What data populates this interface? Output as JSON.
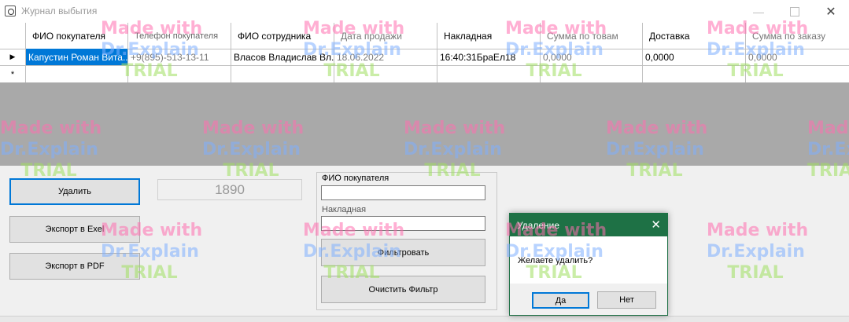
{
  "window": {
    "title": "Журнал выбытия",
    "minimize_glyph": "—",
    "close_glyph": "✕"
  },
  "grid": {
    "columns": [
      "ФИО покупателя",
      "Телефон покупателя",
      "ФИО сотрудника",
      "Дата продажи",
      "Накладная",
      "Сумма по товам",
      "Доставка",
      "Сумма по заказу"
    ],
    "current_row_marker": "▶",
    "new_row_marker": "*",
    "rows": [
      {
        "buyer": "Капустин Роман Вита...",
        "phone": "+9(895)-513-13-11",
        "employee": "Власов Владислав Вл...",
        "date": "18.06.2022",
        "invoice": "16:40:31БраЕл18",
        "sum_goods": "0,0000",
        "delivery": "0,0000",
        "sum_order": "0,0000"
      }
    ]
  },
  "actions": {
    "delete_label": "Удалить",
    "counter_value": "1890",
    "export_excel_label": "Экспорт в Exel",
    "export_pdf_label": "Экспорт в PDF"
  },
  "filter": {
    "buyer_label": "ФИО покупателя",
    "buyer_value": "",
    "invoice_label": "Накладная",
    "invoice_value": "",
    "apply_label": "Фильтровать",
    "clear_label": "Очистить Фильтр"
  },
  "dialog": {
    "title": "Удаление",
    "close_glyph": "✕",
    "message": "Желаете удалить?",
    "yes_label": "Да",
    "no_label": "Нет",
    "accent_color": "#1e7145"
  },
  "watermark": {
    "line1": "Made with",
    "line2": "Dr.Explain",
    "line3": "TRIAL"
  },
  "colors": {
    "selection": "#0078d7",
    "grid_empty_area": "#a9a9a9"
  }
}
